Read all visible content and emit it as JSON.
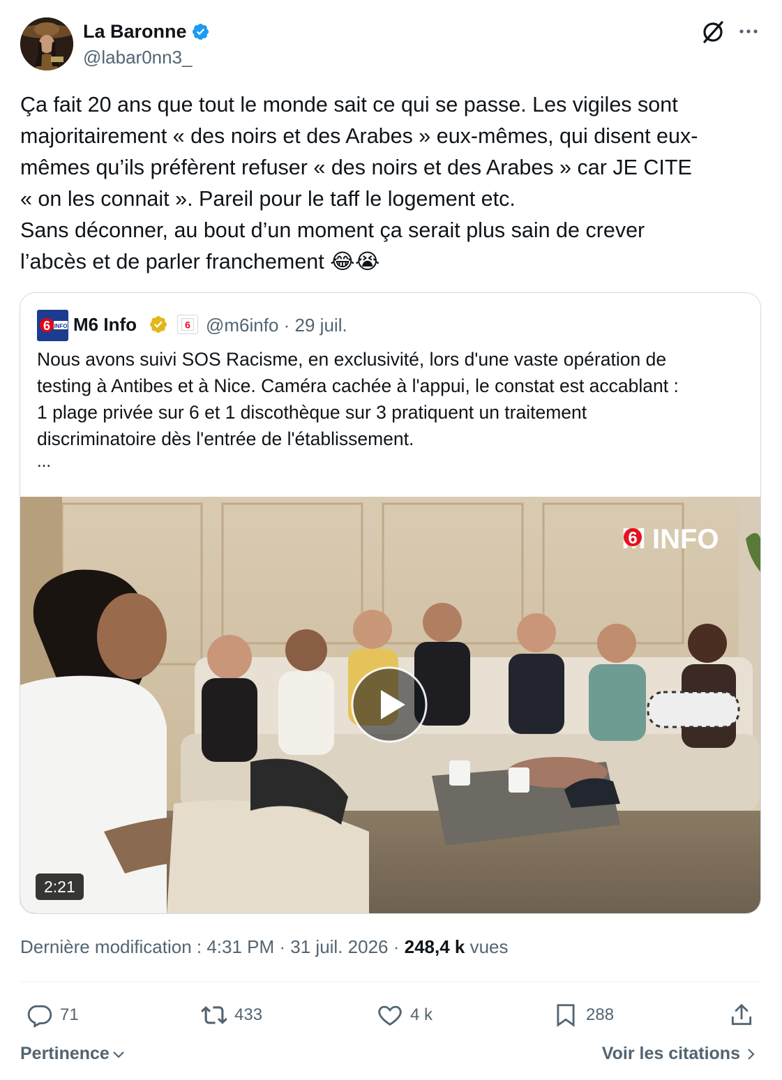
{
  "author": {
    "name": "La Baronne",
    "handle": "@labar0nn3_"
  },
  "tweet": {
    "lines": [
      "Ça fait 20 ans que tout le monde sait ce qui se passe. Les vigiles sont",
      "majoritairement « des noirs et des Arabes » eux-mêmes, qui disent eux-",
      "mêmes qu’ils préfèrent refuser « des noirs et des Arabes » car JE CITE",
      "« on les connait ». Pareil pour le taff le logement etc.",
      "Sans déconner, au bout d’un moment ça serait plus sain de crever",
      "l’abcès et de parler franchement 😂😭"
    ]
  },
  "quote": {
    "name": "M6 Info",
    "handle_date": "@m6info · 29 juil.",
    "lines": [
      "Nous avons suivi SOS Racisme, en exclusivité, lors d'une vaste opération de",
      "testing à Antibes et à Nice. Caméra cachée à l'appui, le constat est accablant :",
      "1 plage privée sur 6 et 1 discothèque sur 3 pratiquent un traitement",
      "discriminatoire dès l'entrée de l'établissement."
    ],
    "ellipsis": "...",
    "video": {
      "duration": "2:21",
      "watermark": "INFO",
      "watermark_digit": "6"
    }
  },
  "meta": {
    "edited": "Dernière modification : 4:31 PM · 31 juil. 2026 · ",
    "views_count": "248,4 k",
    "views_label": " vues"
  },
  "actions": {
    "replies": "71",
    "retweets": "433",
    "likes": "4 k",
    "bookmarks": "288"
  },
  "footer": {
    "sort_label": "Pertinence",
    "quotes_label": "Voir les citations"
  },
  "colors": {
    "verified_blue": "#1d9bf0",
    "gold_badge": "#e2b719",
    "secondary_text": "#536471"
  }
}
